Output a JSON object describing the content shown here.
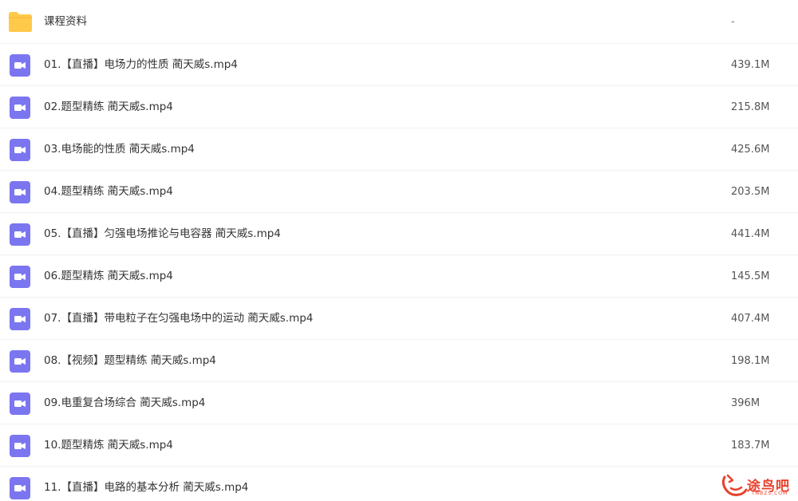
{
  "files": [
    {
      "name": "课程资料",
      "size": "-",
      "kind": "folder"
    },
    {
      "name": "01.【直播】电场力的性质 蔺天威s.mp4",
      "size": "439.1M",
      "kind": "video"
    },
    {
      "name": "02.题型精练 蔺天威s.mp4",
      "size": "215.8M",
      "kind": "video"
    },
    {
      "name": "03.电场能的性质 蔺天威s.mp4",
      "size": "425.6M",
      "kind": "video"
    },
    {
      "name": "04.题型精练 蔺天威s.mp4",
      "size": "203.5M",
      "kind": "video"
    },
    {
      "name": "05.【直播】匀强电场推论与电容器 蔺天威s.mp4",
      "size": "441.4M",
      "kind": "video"
    },
    {
      "name": "06.题型精炼 蔺天威s.mp4",
      "size": "145.5M",
      "kind": "video"
    },
    {
      "name": "07.【直播】带电粒子在匀强电场中的运动 蔺天威s.mp4",
      "size": "407.4M",
      "kind": "video"
    },
    {
      "name": "08.【视频】题型精练 蔺天威s.mp4",
      "size": "198.1M",
      "kind": "video"
    },
    {
      "name": "09.电重复合场综合 蔺天威s.mp4",
      "size": "396M",
      "kind": "video"
    },
    {
      "name": "10.题型精炼 蔺天威s.mp4",
      "size": "183.7M",
      "kind": "video"
    },
    {
      "name": "11.【直播】电路的基本分析 蔺天威s.mp4",
      "size": "",
      "kind": "video"
    }
  ],
  "watermark": {
    "text": "途鸟吧",
    "subtext": "TNBZS.COM"
  },
  "colors": {
    "folder": "#ffc94a",
    "video": "#7b76f0",
    "watermark": "#e8412c"
  }
}
